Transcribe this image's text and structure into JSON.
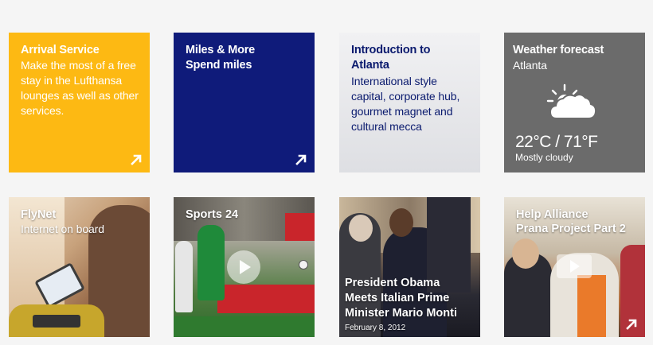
{
  "tiles": {
    "arrival": {
      "title": "Arrival Service",
      "body": "Make the most of a free stay in the Lufthansa lounges as well as other services.",
      "color": "#fdb913",
      "icon": "arrow-up-right-icon"
    },
    "miles": {
      "title_line1": "Miles & More",
      "title_line2": "Spend miles",
      "color": "#0f1b7a",
      "icon": "arrow-up-right-icon"
    },
    "intro": {
      "title": "Introduction to Atlanta",
      "body": "International style capital, corporate hub, gourmet magnet and cultural mecca",
      "color": "#0a1a6e"
    },
    "weather": {
      "title": "Weather forecast",
      "city": "Atlanta",
      "temperature": "22°C / 71°F",
      "condition": "Mostly cloudy",
      "icon": "partly-cloudy-icon"
    },
    "flynet": {
      "title": "FlyNet",
      "subtitle": "Internet on board"
    },
    "sports": {
      "title": "Sports 24",
      "icon": "play-icon"
    },
    "obama": {
      "headline": "President Obama Meets Italian Prime Minister Mario Monti",
      "date": "February 8, 2012"
    },
    "help": {
      "title_line1": "Help Alliance",
      "title_line2": "Prana Project Part 2",
      "icon": "play-icon"
    }
  }
}
